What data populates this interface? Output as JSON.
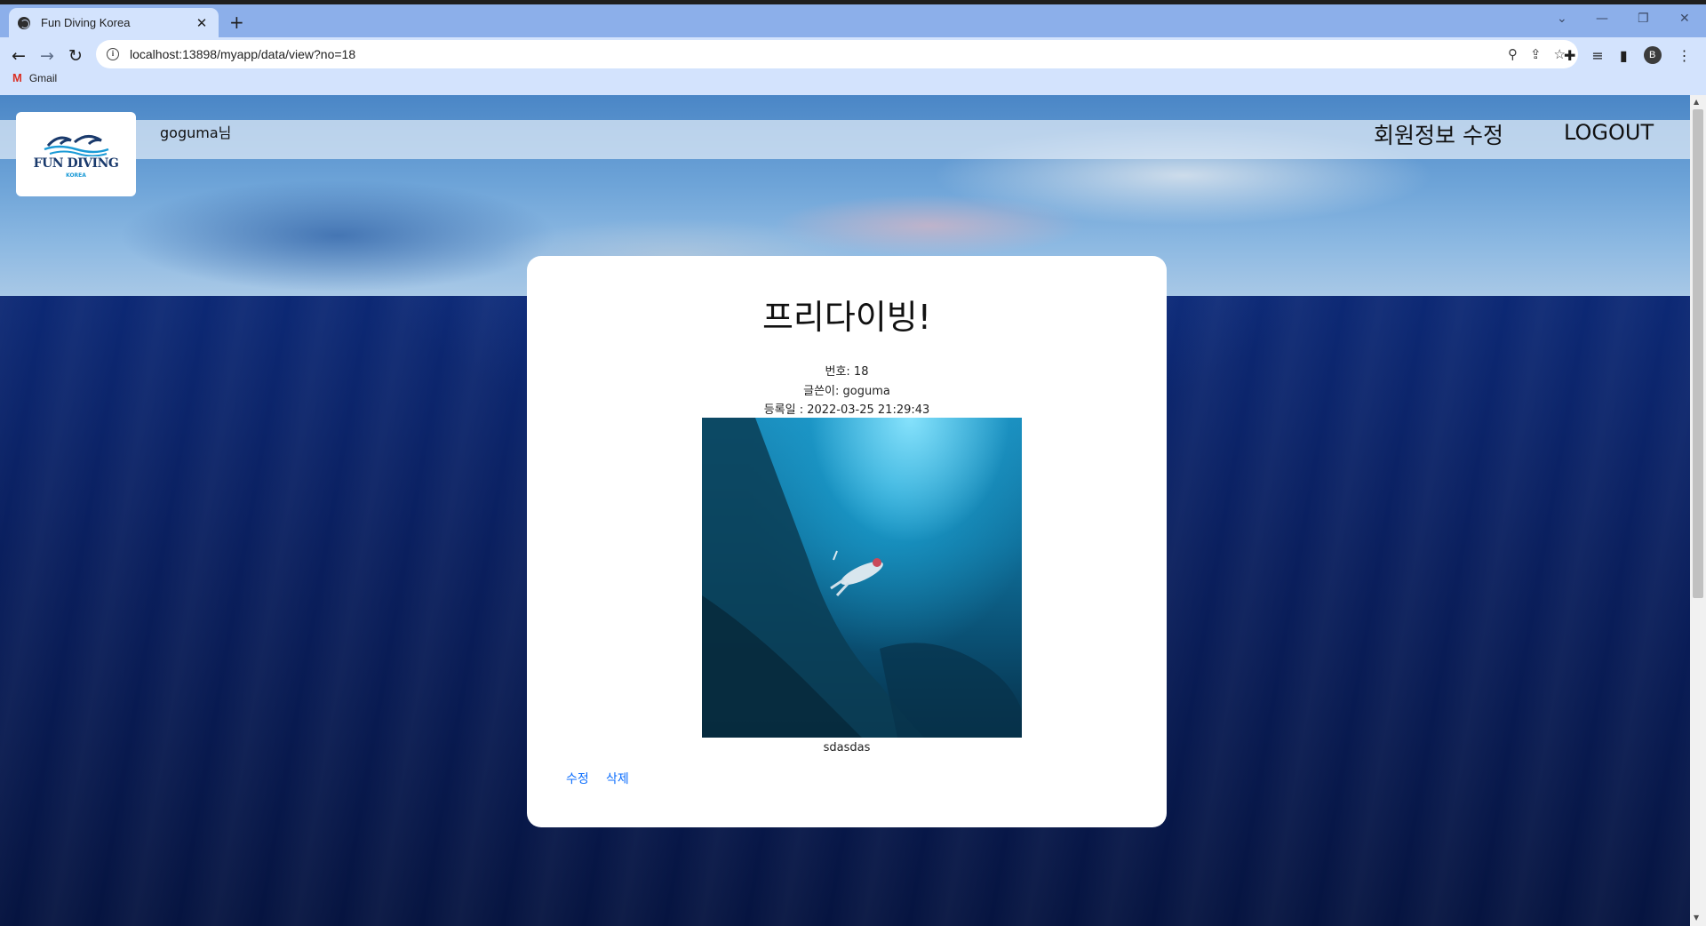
{
  "browser": {
    "tab_title": "Fun Diving Korea",
    "tab_close": "✕",
    "new_tab": "+",
    "url": "localhost:13898/myapp/data/view?no=18",
    "bookmark_gmail": "Gmail",
    "profile_initial": "B",
    "window_controls": [
      "⌄",
      "—",
      "❐",
      "✕"
    ]
  },
  "header": {
    "logo_title": "FUN DIVING",
    "logo_subtitle": "KOREA",
    "username": "goguma님",
    "menu_edit_profile": "회원정보 수정",
    "menu_logout": "LOGOUT"
  },
  "post": {
    "title": "프리다이빙!",
    "number": "번호: 18",
    "author": "글쓴이: goguma",
    "date": "등록일 : 2022-03-25 21:29:43",
    "caption": "sdasdas",
    "edit_label": "수정",
    "delete_label": "삭제"
  },
  "colors": {
    "accent_link": "#0d6efd",
    "tabbar": "#8cafea",
    "toolbar": "#d3e3fd",
    "card": "#ffffff"
  }
}
